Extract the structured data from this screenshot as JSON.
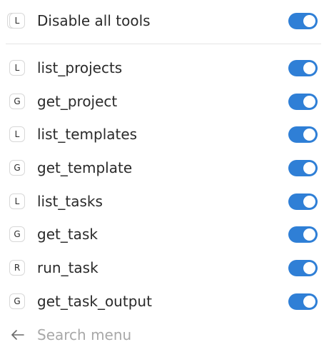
{
  "header_row": {
    "badge": "L",
    "label": "Disable all tools",
    "toggle_on": true
  },
  "tools": [
    {
      "badge": "L",
      "label": "list_projects",
      "toggle_on": true
    },
    {
      "badge": "G",
      "label": "get_project",
      "toggle_on": true
    },
    {
      "badge": "L",
      "label": "list_templates",
      "toggle_on": true
    },
    {
      "badge": "G",
      "label": "get_template",
      "toggle_on": true
    },
    {
      "badge": "L",
      "label": "list_tasks",
      "toggle_on": true
    },
    {
      "badge": "G",
      "label": "get_task",
      "toggle_on": true
    },
    {
      "badge": "R",
      "label": "run_task",
      "toggle_on": true
    },
    {
      "badge": "G",
      "label": "get_task_output",
      "toggle_on": true
    }
  ],
  "search": {
    "icon": "arrow-left-icon",
    "placeholder": "Search menu",
    "value": ""
  },
  "colors": {
    "toggle_on": "#2f7fd6",
    "placeholder": "#a8a8a8",
    "divider": "#e4e4e4"
  }
}
